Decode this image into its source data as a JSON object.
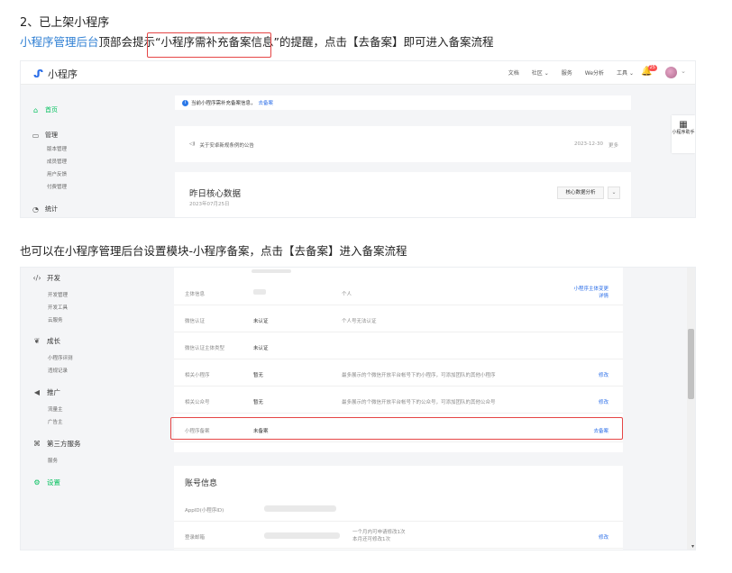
{
  "heading": "2、已上架小程序",
  "intro": {
    "link": "小程序管理后台",
    "rest": "顶部会提示“小程序需补充备案信息”的提醒，点击【去备案】即可进入备案流程"
  },
  "shot1": {
    "logo": "小程序",
    "topnav": [
      "文档",
      "社区",
      "服务",
      "We分析",
      "工具"
    ],
    "bell_badge": "25",
    "sidebar": {
      "home": "首页",
      "manage": "管理",
      "manage_sub": [
        "版本管理",
        "成员管理",
        "用户反馈",
        "付费管理"
      ],
      "stats": "统计"
    },
    "notice": {
      "text": "当前小程序需补充备案信息，",
      "link": "去备案"
    },
    "announcement": {
      "text": "关于安卓新规条例的公告",
      "date": "2023-12-30",
      "more": "更多"
    },
    "core_data": {
      "title": "昨日核心数据",
      "date": "2023年07月25日",
      "button": "核心数据分析"
    },
    "help": {
      "label": "小程序助手"
    }
  },
  "mid_text": "也可以在小程序管理后台设置模块-小程序备案，点击【去备案】进入备案流程",
  "shot2": {
    "sidebar": {
      "develop": "开发",
      "develop_sub": [
        "开发管理",
        "开发工具",
        "云服务"
      ],
      "growth": "成长",
      "growth_sub": [
        "小程序评测",
        "违规记录"
      ],
      "promote": "推广",
      "promote_sub": [
        "流量主",
        "广告主"
      ],
      "third": "第三方服务",
      "third_sub": [
        "服务"
      ],
      "settings": "设置"
    },
    "rows": [
      {
        "label": "主体信息",
        "status": "",
        "desc": "个人",
        "action": "小程序主体变更",
        "action2": "详情"
      },
      {
        "label": "微信认证",
        "status": "未认证",
        "desc": "个人号无法认证",
        "action": ""
      },
      {
        "label": "微信认证主体类型",
        "status": "未认证",
        "desc": "",
        "action": ""
      },
      {
        "label": "相关小程序",
        "status": "暂无",
        "desc": "最多展示的个微信开放平台帐号下的小程序，可添加团队的其他小程序",
        "action": "修改"
      },
      {
        "label": "相关公众号",
        "status": "暂无",
        "desc": "最多展示的个微信开放平台帐号下的公众号，可添加团队的其他公众号",
        "action": "修改"
      },
      {
        "label": "小程序备案",
        "status": "未备案",
        "desc": "",
        "action": "去备案"
      }
    ],
    "account": {
      "title": "账号信息",
      "rows": [
        {
          "label": "AppID(小程序ID)",
          "desc1": "",
          "desc2": "",
          "action": ""
        },
        {
          "label": "登录邮箱",
          "desc1": "一个月内可申请修改1次",
          "desc2": "本月还可修改1次",
          "action": "修改"
        }
      ]
    }
  },
  "colors": {
    "accent_green": "#07c160",
    "link_blue": "#2b6ee8",
    "highlight_red": "#e54545"
  }
}
